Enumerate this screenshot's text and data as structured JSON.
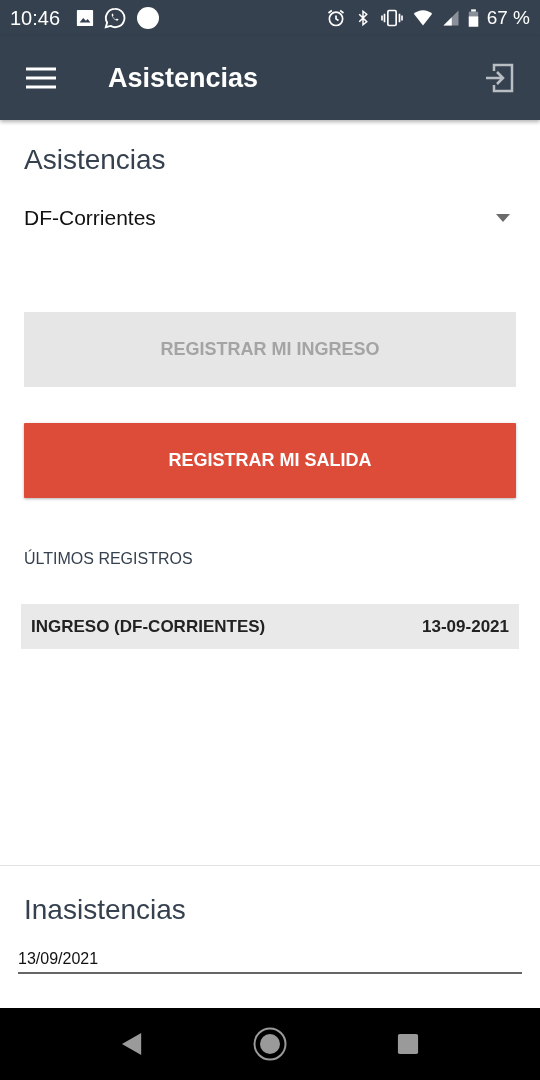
{
  "status_bar": {
    "time": "10:46",
    "battery": "67 %"
  },
  "app_bar": {
    "title": "Asistencias"
  },
  "attendance": {
    "heading": "Asistencias",
    "location_select": {
      "value": "DF-Corrientes"
    },
    "buttons": [
      {
        "label": "REGISTRAR MI INGRESO",
        "disabled": true
      },
      {
        "label": "REGISTRAR MI SALIDA",
        "disabled": false
      }
    ],
    "records_heading": "ÚLTIMOS REGISTROS",
    "records": [
      {
        "type": "INGRESO (DF-CORRIENTES)",
        "date": "13-09-2021"
      }
    ]
  },
  "absences": {
    "heading": "Inasistencias",
    "date_field": {
      "value": "13/09/2021"
    }
  }
}
